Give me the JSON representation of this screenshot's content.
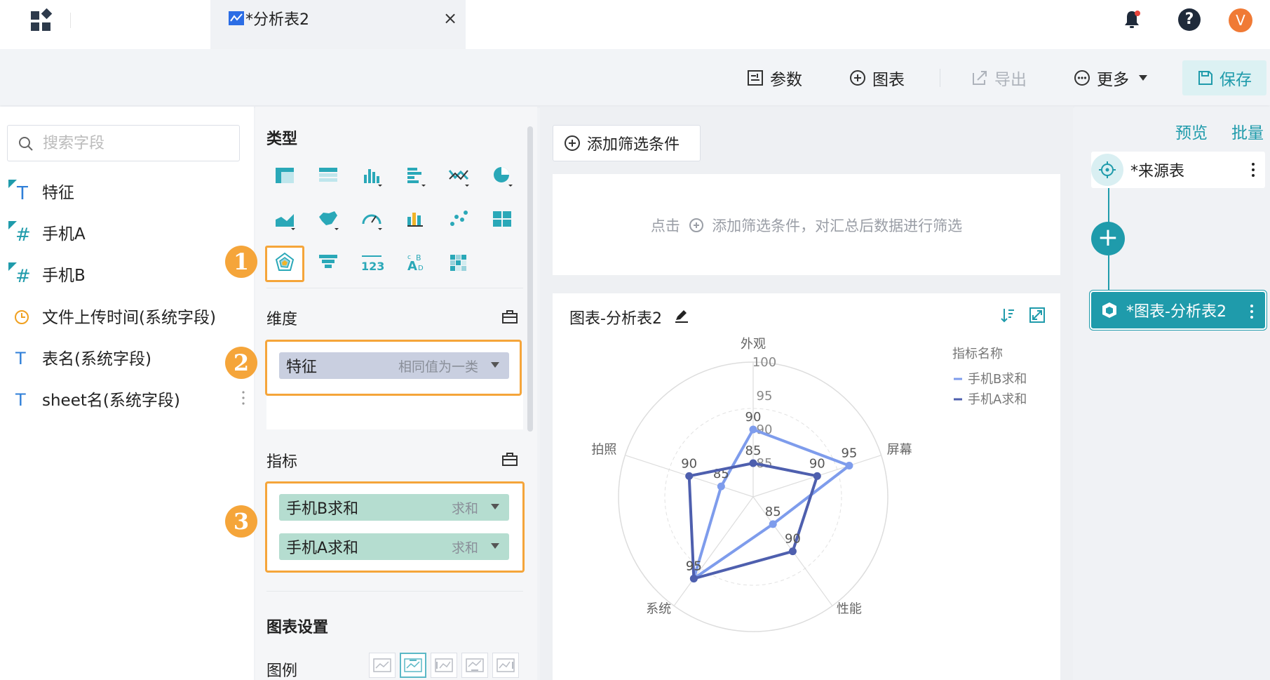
{
  "tabbar": {
    "tab_title": "*分析表2",
    "close_glyph": "×",
    "avatar_letter": "V",
    "help_glyph": "?"
  },
  "toolbar": {
    "params_label": "参数",
    "chart_label": "图表",
    "export_label": "导出",
    "more_label": "更多",
    "save_label": "保存"
  },
  "fields": {
    "search_placeholder": "搜索字段",
    "items": [
      {
        "label": "特征",
        "kind": "text-dim"
      },
      {
        "label": "手机A",
        "kind": "number"
      },
      {
        "label": "手机B",
        "kind": "number"
      },
      {
        "label": "文件上传时间(系统字段)",
        "kind": "time"
      },
      {
        "label": "表名(系统字段)",
        "kind": "text"
      },
      {
        "label": "sheet名(系统字段)",
        "kind": "text"
      }
    ]
  },
  "config": {
    "type_title": "类型",
    "dimension_title": "维度",
    "measure_title": "指标",
    "settings_title": "图表设置",
    "legend_label": "图例",
    "badges": [
      "1",
      "2",
      "3"
    ],
    "dimension": {
      "label": "特征",
      "agg": "相同值为一类"
    },
    "measures": [
      {
        "label": "手机B求和",
        "agg": "求和"
      },
      {
        "label": "手机A求和",
        "agg": "求和"
      }
    ]
  },
  "filter": {
    "add_label": "添加筛选条件",
    "hint_prefix": "点击",
    "hint_suffix": "添加筛选条件，对汇总后数据进行筛选"
  },
  "chart": {
    "card_title": "图表-分析表2",
    "legend_title": "指标名称"
  },
  "flow": {
    "preview_label": "预览",
    "batch_label": "批量",
    "source_node": "*来源表",
    "add_glyph": "+",
    "chart_node": "*图表-分析表2"
  },
  "colors": {
    "accent": "#1f9bab",
    "highlight": "#f5a53a",
    "series_b": "#7e9cec",
    "series_a": "#4e5fae"
  },
  "chart_data": {
    "type": "radar",
    "indicators": [
      "外观",
      "屏幕",
      "性能",
      "系统",
      "拍照"
    ],
    "radial_ticks": [
      "100",
      "95",
      "90",
      "85"
    ],
    "range": [
      80,
      100
    ],
    "legend_title": "指标名称",
    "series": [
      {
        "name": "手机B求和",
        "values": [
          90,
          95,
          85,
          95,
          85
        ]
      },
      {
        "name": "手机A求和",
        "values": [
          85,
          90,
          90,
          95,
          90
        ]
      }
    ]
  }
}
